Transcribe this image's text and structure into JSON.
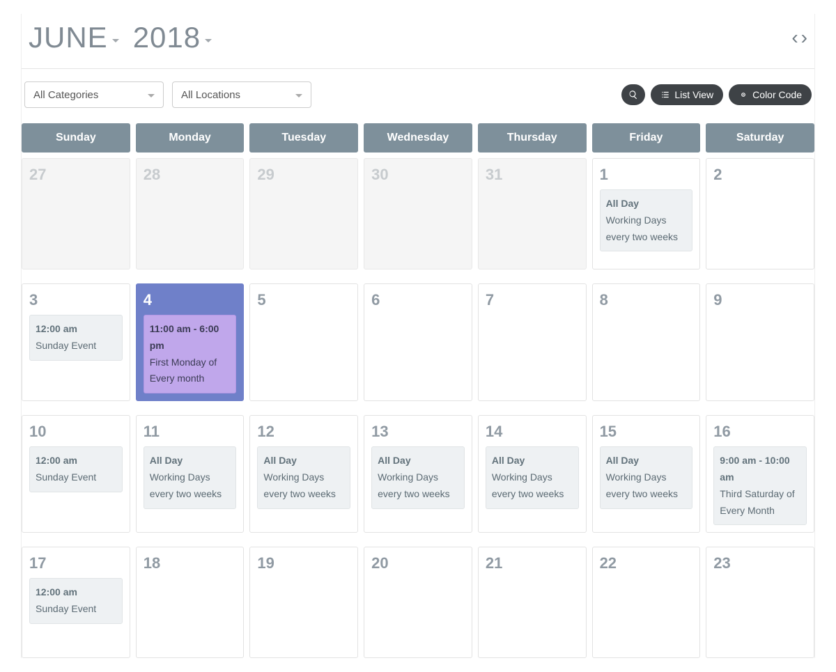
{
  "header": {
    "month": "JUNE",
    "year": "2018"
  },
  "toolbar": {
    "categories": "All Categories",
    "locations": "All Locations",
    "list_view": "List View",
    "color_code": "Color Code"
  },
  "daynames": [
    "Sunday",
    "Monday",
    "Tuesday",
    "Wednesday",
    "Thursday",
    "Friday",
    "Saturday"
  ],
  "weeks": [
    [
      {
        "num": "27",
        "outside": true,
        "events": []
      },
      {
        "num": "28",
        "outside": true,
        "events": []
      },
      {
        "num": "29",
        "outside": true,
        "events": []
      },
      {
        "num": "30",
        "outside": true,
        "events": []
      },
      {
        "num": "31",
        "outside": true,
        "events": []
      },
      {
        "num": "1",
        "outside": false,
        "events": [
          {
            "time": "All Day",
            "title": "Working Days every two weeks",
            "style": "default"
          }
        ]
      },
      {
        "num": "2",
        "outside": false,
        "events": []
      }
    ],
    [
      {
        "num": "3",
        "outside": false,
        "events": [
          {
            "time": "12:00 am",
            "title": "Sunday Event",
            "style": "default"
          }
        ]
      },
      {
        "num": "4",
        "outside": false,
        "highlight": true,
        "events": [
          {
            "time": "11:00 am - 6:00 pm",
            "title": "First Monday of Every month",
            "style": "purple"
          }
        ]
      },
      {
        "num": "5",
        "outside": false,
        "events": []
      },
      {
        "num": "6",
        "outside": false,
        "events": []
      },
      {
        "num": "7",
        "outside": false,
        "events": []
      },
      {
        "num": "8",
        "outside": false,
        "events": []
      },
      {
        "num": "9",
        "outside": false,
        "events": []
      }
    ],
    [
      {
        "num": "10",
        "outside": false,
        "events": [
          {
            "time": "12:00 am",
            "title": "Sunday Event",
            "style": "default"
          }
        ]
      },
      {
        "num": "11",
        "outside": false,
        "events": [
          {
            "time": "All Day",
            "title": "Working Days every two weeks",
            "style": "default"
          }
        ]
      },
      {
        "num": "12",
        "outside": false,
        "events": [
          {
            "time": "All Day",
            "title": "Working Days every two weeks",
            "style": "default"
          }
        ]
      },
      {
        "num": "13",
        "outside": false,
        "events": [
          {
            "time": "All Day",
            "title": "Working Days every two weeks",
            "style": "default"
          }
        ]
      },
      {
        "num": "14",
        "outside": false,
        "events": [
          {
            "time": "All Day",
            "title": "Working Days every two weeks",
            "style": "default"
          }
        ]
      },
      {
        "num": "15",
        "outside": false,
        "events": [
          {
            "time": "All Day",
            "title": "Working Days every two weeks",
            "style": "default"
          }
        ]
      },
      {
        "num": "16",
        "outside": false,
        "events": [
          {
            "time": "9:00 am - 10:00 am",
            "title": "Third Saturday of Every Month",
            "style": "default"
          }
        ]
      }
    ],
    [
      {
        "num": "17",
        "outside": false,
        "events": [
          {
            "time": "12:00 am",
            "title": "Sunday Event",
            "style": "default"
          }
        ]
      },
      {
        "num": "18",
        "outside": false,
        "events": []
      },
      {
        "num": "19",
        "outside": false,
        "events": []
      },
      {
        "num": "20",
        "outside": false,
        "events": []
      },
      {
        "num": "21",
        "outside": false,
        "events": []
      },
      {
        "num": "22",
        "outside": false,
        "events": []
      },
      {
        "num": "23",
        "outside": false,
        "events": []
      }
    ]
  ]
}
